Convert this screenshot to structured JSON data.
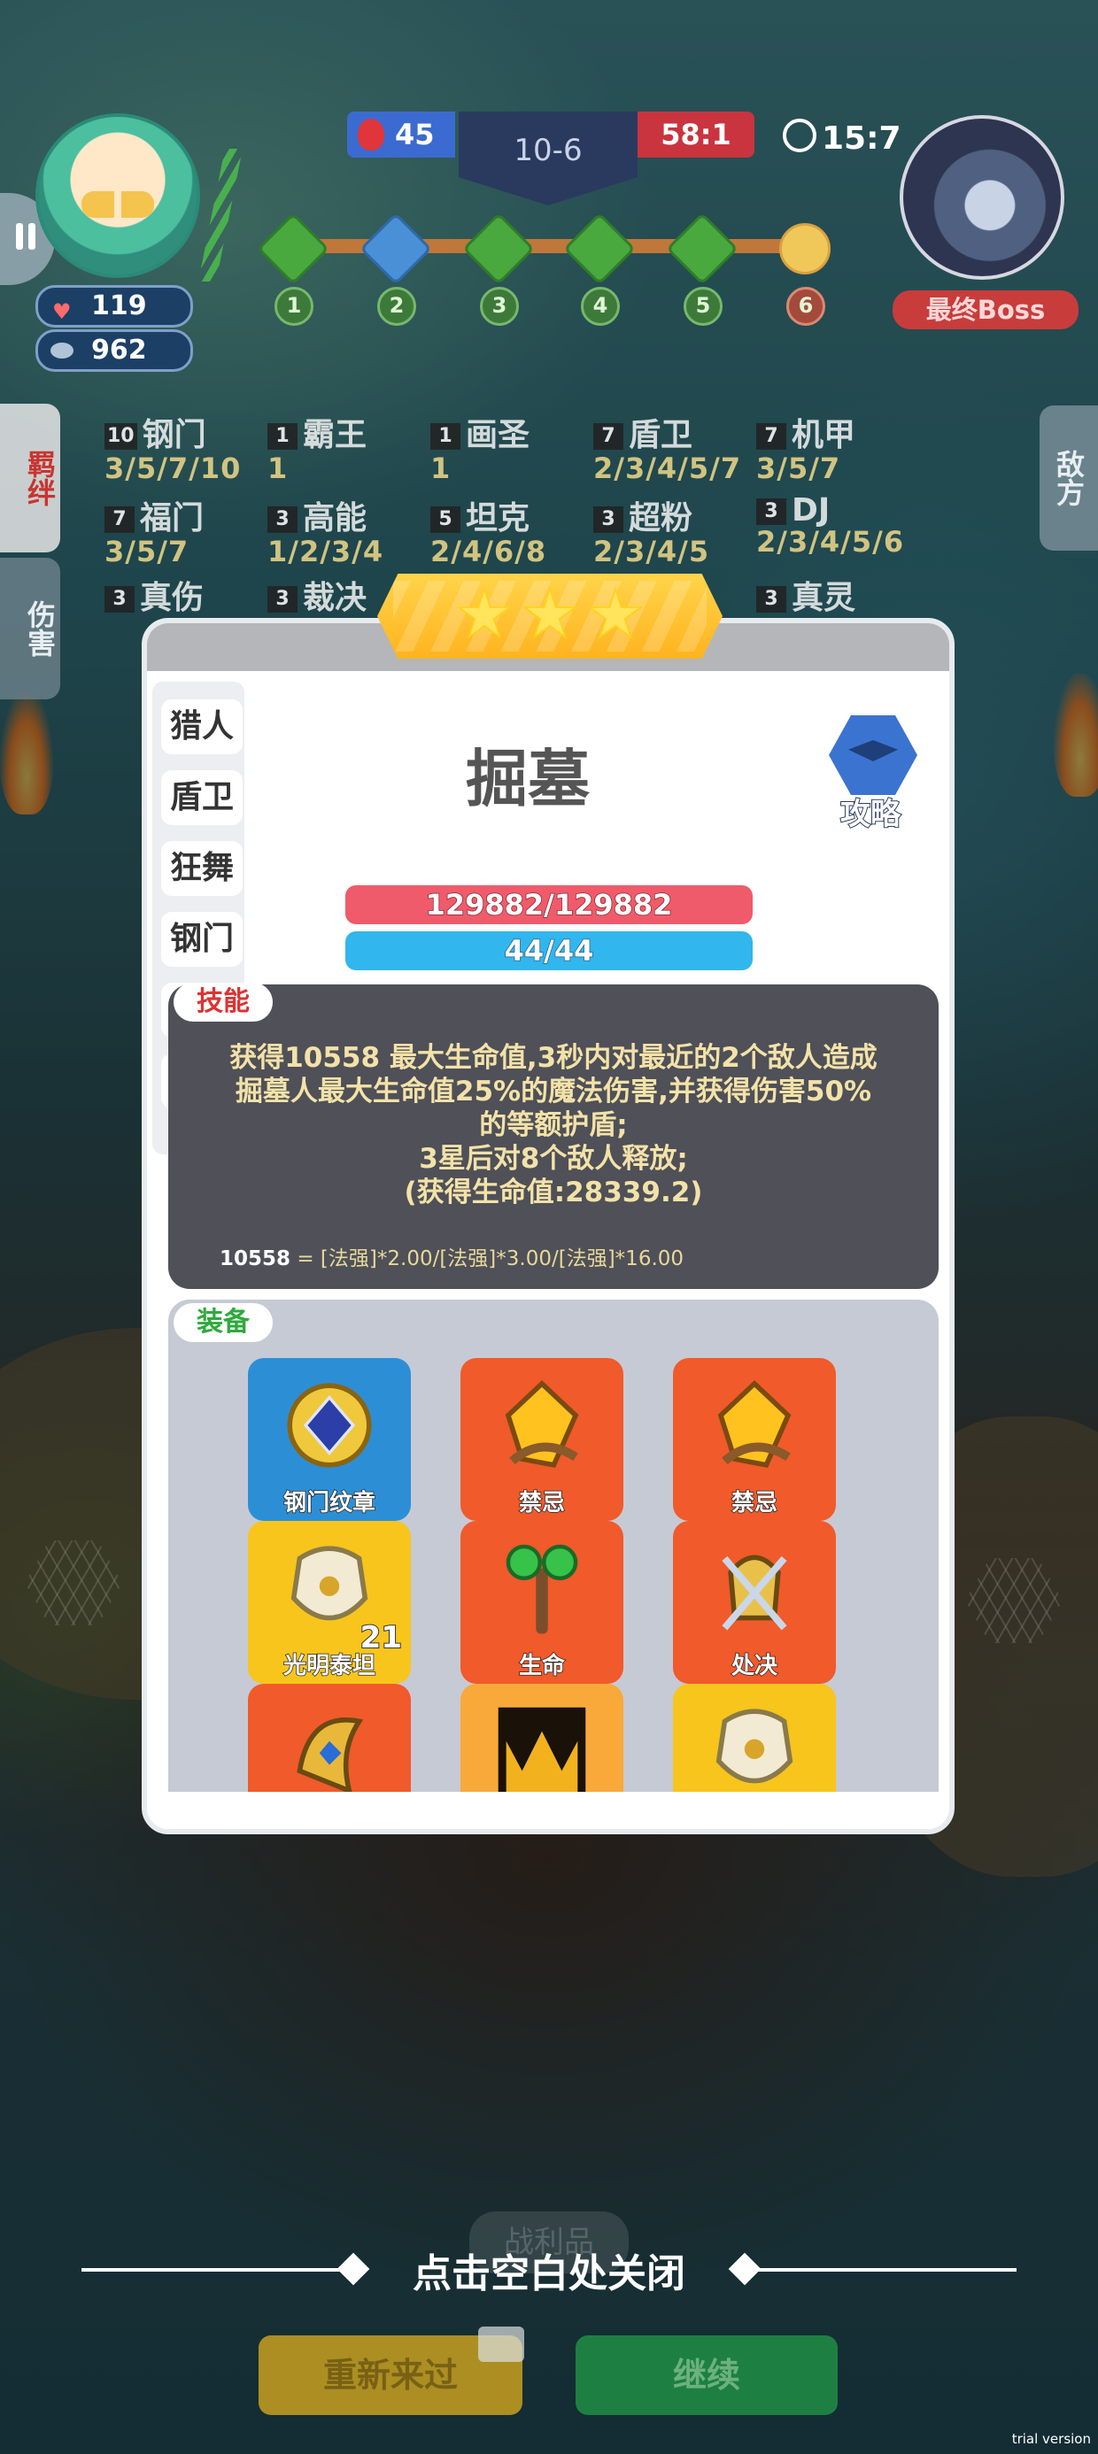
{
  "hud": {
    "player_hp": "119",
    "player_coins": "962",
    "score_left": "45",
    "stage": "10-6",
    "score_right": "58:1",
    "timer": "15:7",
    "boss_label": "最终Boss",
    "progress_nodes": [
      "1",
      "2",
      "3",
      "4",
      "5",
      "6"
    ]
  },
  "side_tabs": {
    "synergy": "羁绊",
    "damage": "伤害",
    "enemy": "敌方"
  },
  "synergies": [
    {
      "count": "10",
      "name": "钢门",
      "levels": "3/5/7/10"
    },
    {
      "count": "1",
      "name": "霸王",
      "levels": "1"
    },
    {
      "count": "1",
      "name": "画圣",
      "levels": "1"
    },
    {
      "count": "7",
      "name": "盾卫",
      "levels": "2/3/4/5/7"
    },
    {
      "count": "7",
      "name": "机甲",
      "levels": "3/5/7"
    },
    {
      "count": "7",
      "name": "福门",
      "levels": "3/5/7"
    },
    {
      "count": "3",
      "name": "高能",
      "levels": "1/2/3/4"
    },
    {
      "count": "5",
      "name": "坦克",
      "levels": "2/4/6/8"
    },
    {
      "count": "3",
      "name": "超粉",
      "levels": "2/3/4/5"
    },
    {
      "count": "3",
      "name": "DJ",
      "levels": "2/3/4/5/6"
    },
    {
      "count": "3",
      "name": "真伤",
      "levels": ""
    },
    {
      "count": "3",
      "name": "裁决",
      "levels": ""
    },
    {
      "count": "3",
      "name": "真灵",
      "levels": ""
    }
  ],
  "modal": {
    "stars": 3,
    "hero_list": [
      "猎人",
      "盾卫",
      "狂舞",
      "钢门"
    ],
    "hero_name": "掘墓",
    "guide_label": "攻略",
    "hp": "129882/129882",
    "mana": "44/44",
    "skill_tag": "技能",
    "skill_text": "获得10558 最大生命值,3秒内对最近的2个敌人造成\n掘墓人最大生命值25%的魔法伤害,并获得伤害50%\n的等额护盾;\n3星后对8个敌人释放;\n(获得生命值:28339.2)",
    "skill_formula_value": "10558",
    "skill_formula_rest": " = [法强]*2.00/[法强]*3.00/[法强]*16.00",
    "equip_tag": "装备",
    "equipment": [
      {
        "name": "钢门纹章",
        "color": "blue",
        "icon": "emblem-icon"
      },
      {
        "name": "禁忌",
        "color": "orange",
        "icon": "crystal-icon"
      },
      {
        "name": "禁忌",
        "color": "orange",
        "icon": "crystal-icon"
      },
      {
        "name": "光明泰坦",
        "color": "yellow",
        "icon": "titan-armor-icon",
        "badge": "21"
      },
      {
        "name": "生命",
        "color": "orange",
        "icon": "life-staff-icon"
      },
      {
        "name": "处决",
        "color": "orange",
        "icon": "execution-helmet-icon"
      },
      {
        "name": "",
        "color": "orange",
        "icon": "gold-helmet-icon"
      },
      {
        "name": "",
        "color": "lorange",
        "icon": "crown-icon"
      },
      {
        "name": "",
        "color": "yellow",
        "icon": "titan-armor-icon"
      }
    ]
  },
  "bottom": {
    "close_hint": "点击空白处关闭",
    "ghost_label": "战利品",
    "retry_label": "重新来过",
    "continue_label": "继续"
  },
  "watermark": "trial version",
  "colors": {
    "hp": "#ef5b6a",
    "mana": "#32b6ee",
    "accent": "#ffc526"
  }
}
